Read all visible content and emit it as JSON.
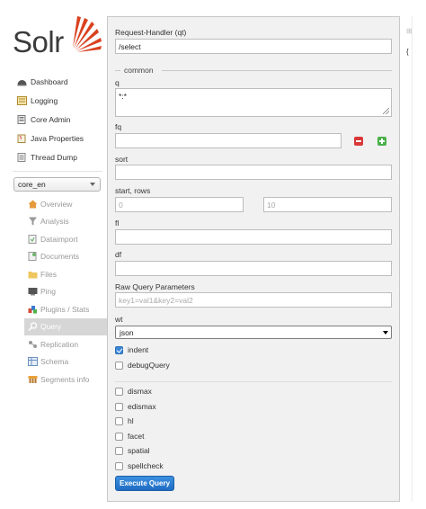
{
  "brand": {
    "name": "Solr",
    "accent": "#d9411e"
  },
  "nav": {
    "items": [
      {
        "label": "Dashboard",
        "icon": "dashboard-icon"
      },
      {
        "label": "Logging",
        "icon": "logging-icon"
      },
      {
        "label": "Core Admin",
        "icon": "core-admin-icon"
      },
      {
        "label": "Java Properties",
        "icon": "java-icon"
      },
      {
        "label": "Thread Dump",
        "icon": "thread-dump-icon"
      }
    ]
  },
  "core_selector": {
    "value": "core_en"
  },
  "core_menu": {
    "items": [
      {
        "label": "Overview",
        "icon": "home-icon",
        "active": false
      },
      {
        "label": "Analysis",
        "icon": "funnel-icon",
        "active": false
      },
      {
        "label": "Dataimport",
        "icon": "dataimport-icon",
        "active": false
      },
      {
        "label": "Documents",
        "icon": "documents-icon",
        "active": false
      },
      {
        "label": "Files",
        "icon": "files-icon",
        "active": false
      },
      {
        "label": "Ping",
        "icon": "ping-icon",
        "active": false
      },
      {
        "label": "Plugins / Stats",
        "icon": "plugins-icon",
        "active": false
      },
      {
        "label": "Query",
        "icon": "magnifier-icon",
        "active": true
      },
      {
        "label": "Replication",
        "icon": "replication-icon",
        "active": false
      },
      {
        "label": "Schema",
        "icon": "schema-icon",
        "active": false
      },
      {
        "label": "Segments info",
        "icon": "segments-icon",
        "active": false
      }
    ]
  },
  "query_form": {
    "request_handler": {
      "label": "Request-Handler (qt)",
      "value": "/select"
    },
    "common_legend": "common",
    "q": {
      "label": "q",
      "value": "*:*"
    },
    "fq": {
      "label": "fq",
      "value": ""
    },
    "sort": {
      "label": "sort",
      "value": ""
    },
    "start_rows": {
      "label": "start, rows",
      "start": "0",
      "rows": "10"
    },
    "fl": {
      "label": "fl",
      "value": ""
    },
    "df": {
      "label": "df",
      "value": ""
    },
    "raw": {
      "label": "Raw Query Parameters",
      "placeholder": "key1=val1&key2=val2"
    },
    "wt": {
      "label": "wt",
      "value": "json"
    },
    "checkboxes": [
      {
        "label": "indent",
        "checked": true
      },
      {
        "label": "debugQuery",
        "checked": false
      }
    ],
    "options": [
      {
        "label": "dismax",
        "checked": false
      },
      {
        "label": "edismax",
        "checked": false
      },
      {
        "label": "hl",
        "checked": false
      },
      {
        "label": "facet",
        "checked": false
      },
      {
        "label": "spatial",
        "checked": false
      },
      {
        "label": "spellcheck",
        "checked": false
      }
    ],
    "execute_label": "Execute Query"
  },
  "result": {
    "brace": "{"
  }
}
